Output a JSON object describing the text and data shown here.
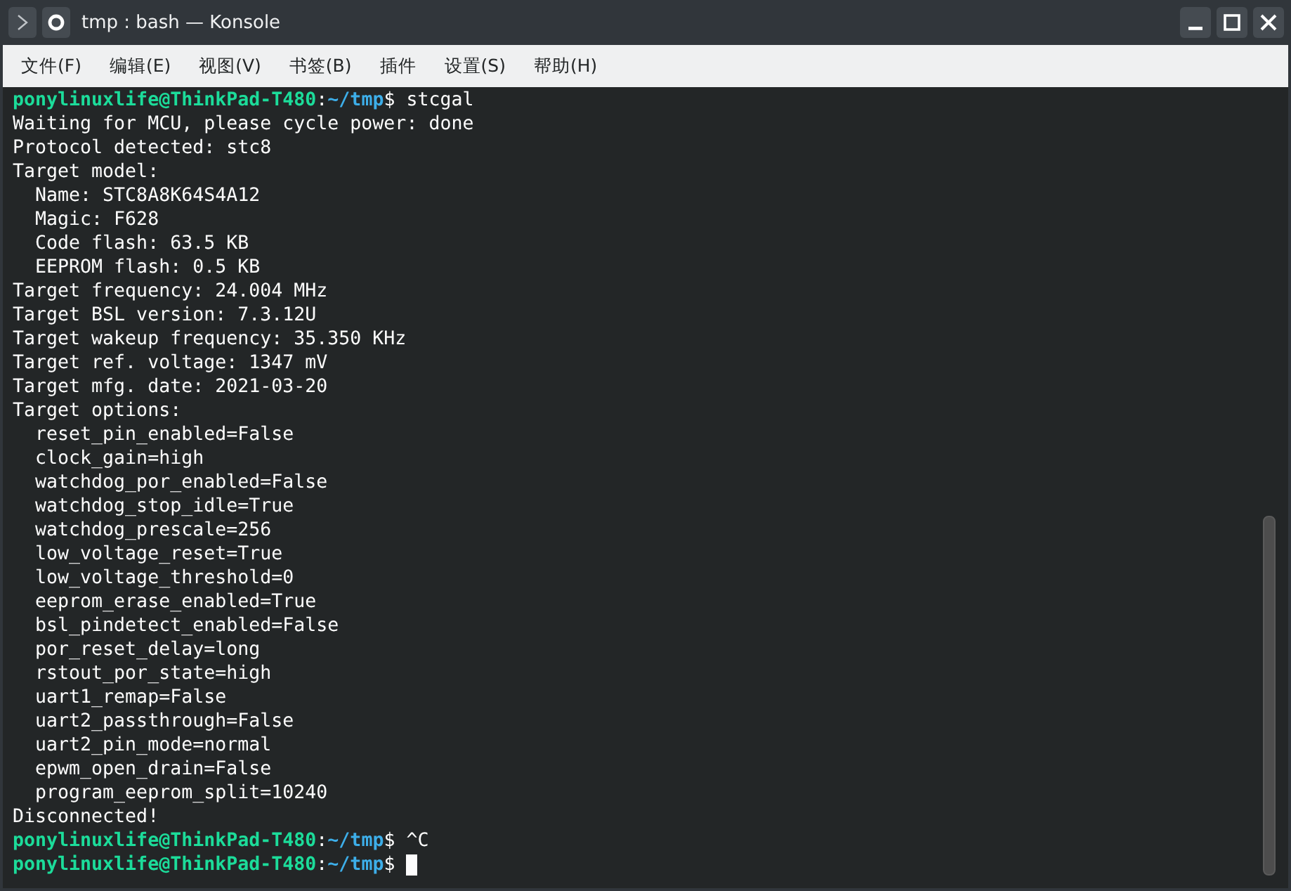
{
  "window": {
    "title": "tmp : bash — Konsole"
  },
  "menu": [
    {
      "label": "文件(F)"
    },
    {
      "label": "编辑(E)"
    },
    {
      "label": "视图(V)"
    },
    {
      "label": "书签(B)"
    },
    {
      "label": "插件"
    },
    {
      "label": "设置(S)"
    },
    {
      "label": "帮助(H)"
    }
  ],
  "terminal": {
    "lines": [
      {
        "kind": "prompt",
        "user_host": "ponylinuxlife@ThinkPad-T480",
        "separator": ":",
        "path": "~/tmp",
        "symbol": "$",
        "command": "stcgal",
        "cursor": false
      },
      {
        "kind": "output",
        "text": "Waiting for MCU, please cycle power: done"
      },
      {
        "kind": "output",
        "text": "Protocol detected: stc8"
      },
      {
        "kind": "output",
        "text": "Target model:"
      },
      {
        "kind": "output",
        "text": "  Name: STC8A8K64S4A12"
      },
      {
        "kind": "output",
        "text": "  Magic: F628"
      },
      {
        "kind": "output",
        "text": "  Code flash: 63.5 KB"
      },
      {
        "kind": "output",
        "text": "  EEPROM flash: 0.5 KB"
      },
      {
        "kind": "output",
        "text": "Target frequency: 24.004 MHz"
      },
      {
        "kind": "output",
        "text": "Target BSL version: 7.3.12U"
      },
      {
        "kind": "output",
        "text": "Target wakeup frequency: 35.350 KHz"
      },
      {
        "kind": "output",
        "text": "Target ref. voltage: 1347 mV"
      },
      {
        "kind": "output",
        "text": "Target mfg. date: 2021-03-20"
      },
      {
        "kind": "output",
        "text": "Target options:"
      },
      {
        "kind": "output",
        "text": "  reset_pin_enabled=False"
      },
      {
        "kind": "output",
        "text": "  clock_gain=high"
      },
      {
        "kind": "output",
        "text": "  watchdog_por_enabled=False"
      },
      {
        "kind": "output",
        "text": "  watchdog_stop_idle=True"
      },
      {
        "kind": "output",
        "text": "  watchdog_prescale=256"
      },
      {
        "kind": "output",
        "text": "  low_voltage_reset=True"
      },
      {
        "kind": "output",
        "text": "  low_voltage_threshold=0"
      },
      {
        "kind": "output",
        "text": "  eeprom_erase_enabled=True"
      },
      {
        "kind": "output",
        "text": "  bsl_pindetect_enabled=False"
      },
      {
        "kind": "output",
        "text": "  por_reset_delay=long"
      },
      {
        "kind": "output",
        "text": "  rstout_por_state=high"
      },
      {
        "kind": "output",
        "text": "  uart1_remap=False"
      },
      {
        "kind": "output",
        "text": "  uart2_passthrough=False"
      },
      {
        "kind": "output",
        "text": "  uart2_pin_mode=normal"
      },
      {
        "kind": "output",
        "text": "  epwm_open_drain=False"
      },
      {
        "kind": "output",
        "text": "  program_eeprom_split=10240"
      },
      {
        "kind": "output",
        "text": "Disconnected!"
      },
      {
        "kind": "prompt",
        "user_host": "ponylinuxlife@ThinkPad-T480",
        "separator": ":",
        "path": "~/tmp",
        "symbol": "$",
        "command": "^C",
        "cursor": false
      },
      {
        "kind": "prompt",
        "user_host": "ponylinuxlife@ThinkPad-T480",
        "separator": ":",
        "path": "~/tmp",
        "symbol": "$",
        "cursor": true
      }
    ]
  }
}
